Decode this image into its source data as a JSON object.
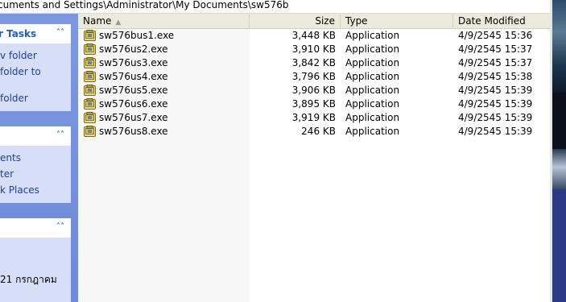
{
  "address_bar": {
    "path": "cuments and Settings\\Administrator\\My Documents\\sw576b"
  },
  "task_pane": {
    "groups": [
      {
        "title": "r Tasks",
        "items": [
          "v folder",
          " folder to",
          "folder"
        ]
      },
      {
        "title": "",
        "items": [
          "ents",
          "ter",
          "k Places"
        ]
      },
      {
        "title": "",
        "items": [
          "21 กรกฎาคม"
        ]
      }
    ]
  },
  "file_list": {
    "columns": {
      "name": "Name",
      "size": "Size",
      "type": "Type",
      "date": "Date Modified"
    },
    "files": [
      {
        "name": "sw576bus1.exe",
        "size": "3,448 KB",
        "type": "Application",
        "date": "4/9/2545 15:36"
      },
      {
        "name": "sw576us2.exe",
        "size": "3,910 KB",
        "type": "Application",
        "date": "4/9/2545 15:37"
      },
      {
        "name": "sw576us3.exe",
        "size": "3,842 KB",
        "type": "Application",
        "date": "4/9/2545 15:37"
      },
      {
        "name": "sw576us4.exe",
        "size": "3,796 KB",
        "type": "Application",
        "date": "4/9/2545 15:38"
      },
      {
        "name": "sw576us5.exe",
        "size": "3,906 KB",
        "type": "Application",
        "date": "4/9/2545 15:39"
      },
      {
        "name": "sw576us6.exe",
        "size": "3,895 KB",
        "type": "Application",
        "date": "4/9/2545 15:39"
      },
      {
        "name": "sw576us7.exe",
        "size": "3,919 KB",
        "type": "Application",
        "date": "4/9/2545 15:39"
      },
      {
        "name": "sw576us8.exe",
        "size": "246 KB",
        "type": "Application",
        "date": "4/9/2545 15:39"
      }
    ]
  },
  "icons": {
    "file": "installer-exe-icon",
    "collapse": "chevron-up-icon",
    "sort": "sort-ascending-icon"
  },
  "colors": {
    "pane_link": "#1f3f9f",
    "pane_bg": "#7d98e1",
    "header_bg": "#ebeadb"
  }
}
